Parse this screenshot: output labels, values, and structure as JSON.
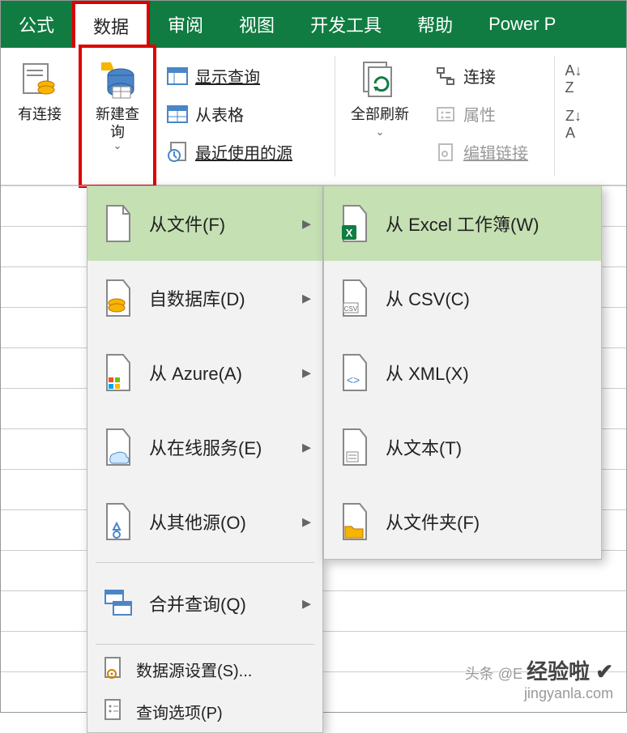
{
  "tabs": {
    "t0": "公式",
    "t1": "数据",
    "t2": "审阅",
    "t3": "视图",
    "t4": "开发工具",
    "t5": "帮助",
    "t6": "Power P"
  },
  "toolbar": {
    "existing_conn": "有连接",
    "new_query": "新建查\n询",
    "show_query": "显示查询",
    "from_table": "从表格",
    "recent_src": "最近使用的源",
    "refresh_all": "全部刷新",
    "connections": "连接",
    "properties": "属性",
    "edit_links": "编辑链接"
  },
  "menu1": {
    "from_file": "从文件(F)",
    "from_db": "自数据库(D)",
    "from_azure": "从 Azure(A)",
    "from_online": "从在线服务(E)",
    "from_other": "从其他源(O)",
    "merge_query": "合并查询(Q)",
    "ds_settings": "数据源设置(S)...",
    "query_opts": "查询选项(P)"
  },
  "menu2": {
    "from_excel": "从 Excel 工作簿(W)",
    "from_csv": "从 CSV(C)",
    "from_xml": "从 XML(X)",
    "from_text": "从文本(T)",
    "from_folder": "从文件夹(F)"
  },
  "watermark": {
    "l1": "头条 @E",
    "l2": "经验啦 ✔",
    "l3": "jingyanla.com"
  }
}
